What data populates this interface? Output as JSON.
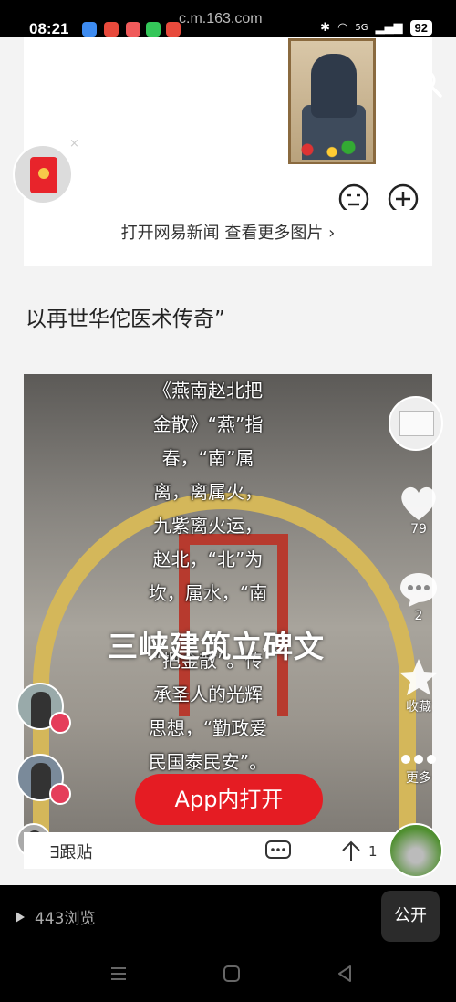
{
  "status_bar": {
    "time": "08:21",
    "url": "c.m.163.com",
    "network": "5G",
    "battery": "92"
  },
  "web": {
    "open_app_link": "打开网易新闻 查看更多图片 ›",
    "article_text": "以再世华佗医术传奇”",
    "close_mark": "×"
  },
  "video": {
    "lines": [
      "《燕南赵北把",
      "金散》“燕”指",
      "春，“南”属",
      "离，离属火，",
      "九紫离火运，",
      "赵北，“北”为",
      "坎，属水，“南",
      "",
      "“把金散”。传",
      "承圣人的光辉",
      "思想，“勤政爱",
      "民国泰民安”。"
    ],
    "title": "三峡建筑立碑文",
    "app_button": "App内打开",
    "like_count": "79",
    "comment_count": "2",
    "favorite_label": "收藏",
    "more_label": "更多"
  },
  "bottom_bar": {
    "follow_label": "∃跟贴",
    "share_count": "1"
  },
  "post_footer": {
    "views": "443浏览",
    "public_button": "公开"
  }
}
